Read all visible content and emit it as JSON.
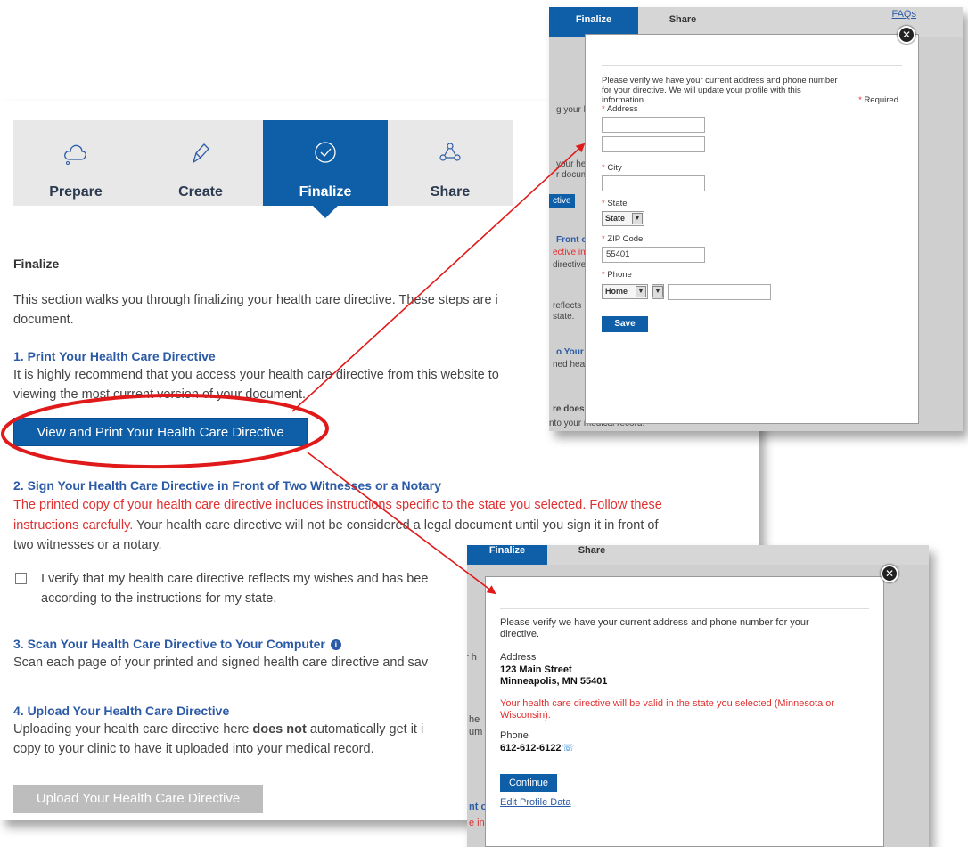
{
  "steps": [
    {
      "label": "Prepare",
      "icon": "cloud-icon"
    },
    {
      "label": "Create",
      "icon": "pen-icon"
    },
    {
      "label": "Finalize",
      "icon": "check-circle-icon"
    },
    {
      "label": "Share",
      "icon": "share-nodes-icon"
    }
  ],
  "main": {
    "section_title": "Finalize",
    "intro_line1": "This section walks you through finalizing your health care directive. These steps are i",
    "intro_line2": "document.",
    "step1": {
      "title": "1. Print Your Health Care Directive",
      "line1": "It is highly recommend that you access your health care directive from this website to",
      "line2": "viewing the most current version of your document.",
      "button": "View and Print Your Health Care Directive"
    },
    "step2": {
      "title": "2. Sign Your Health Care Directive in Front of Two Witnesses or a Notary",
      "red_line1": "The printed copy of your health care directive includes instructions specific to the state you selected. Follow these",
      "red_line2": "instructions carefully.",
      "line2_rest": " Your health care directive will not be considered a legal document until you sign it in front of",
      "line3": "two witnesses or a notary.",
      "checkbox_line1": "I verify that my health care directive reflects my wishes and has bee",
      "checkbox_line2": "according to the instructions for my state."
    },
    "step3": {
      "title": "3. Scan Your Health Care Directive to Your Computer",
      "line1": "Scan each page of your printed and signed health care directive and sav"
    },
    "step4": {
      "title": "4. Upload Your Health Care Directive",
      "line1_pre": "Uploading your health care directive here ",
      "line1_bold": "does not",
      "line1_post": " automatically get it i",
      "line2": "copy to your clinic to have it uploaded into your medical record.",
      "button": "Upload Your Health Care Directive"
    }
  },
  "popupA": {
    "tab_finalize": "Finalize",
    "tab_share": "Share",
    "faqs": "FAQs",
    "behind_text": {
      "t1": "g your h",
      "t2": "your he",
      "t3": "r docum",
      "t4": "ctive",
      "t5": "Front o",
      "t6": "ective in",
      "t7": "directive",
      "t8": "reflects",
      "t9": "state.",
      "t10": "o Your C",
      "t11": "ned hea",
      "t12": "re does",
      "t13": "nto your medical record."
    },
    "intro": "Please verify we have your current address and phone number for your directive. We will update your profile with this information.",
    "required": "Required",
    "address_label": "Address",
    "city_label": "City",
    "state_label": "State",
    "state_value": "State",
    "zip_label": "ZIP Code",
    "zip_value": "55401",
    "phone_label": "Phone",
    "phone_type": "Home",
    "save": "Save"
  },
  "popupB": {
    "tab_finalize": "Finalize",
    "tab_share": "Share",
    "intro": "Please verify we have your current address and phone number for your directive.",
    "address_label": "Address",
    "address_line1": "123 Main Street",
    "address_line2": "Minneapolis, MN 55401",
    "valid_note": "Your health care directive will be valid in the state you selected (Minnesota or Wisconsin).",
    "phone_label": "Phone",
    "phone_value": "612-612-6122",
    "continue": "Continue",
    "edit_link": "Edit Profile Data",
    "behind_text": {
      "t1": "r h",
      "t2": "he",
      "t3": "um",
      "t4": "nt o",
      "t5": "e in"
    }
  },
  "annotation_colors": {
    "circle": "#e01a1a",
    "arrow": "#e01a1a"
  }
}
